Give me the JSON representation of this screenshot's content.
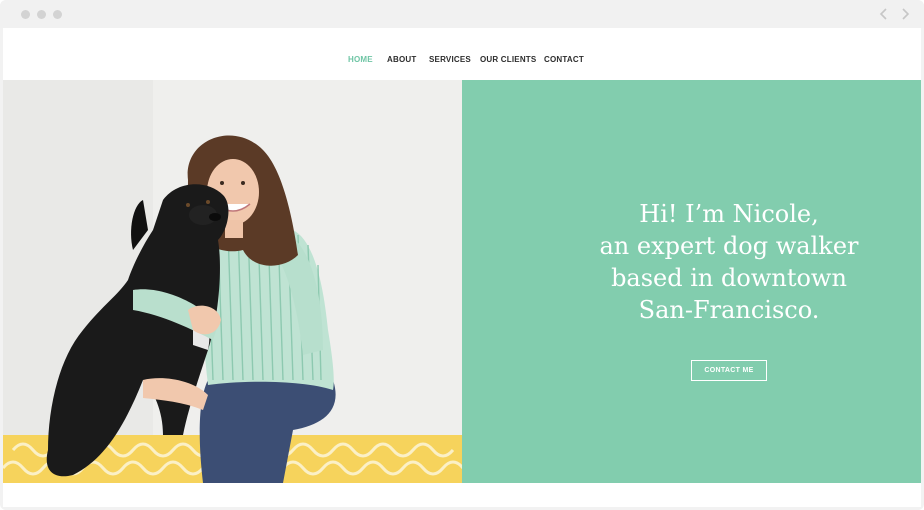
{
  "window": {
    "controls": [
      "close-dot",
      "minimize-dot",
      "zoom-dot"
    ],
    "back_icon": "chevron-left-icon",
    "forward_icon": "chevron-right-icon"
  },
  "nav": {
    "items": [
      {
        "label": "HOME",
        "active": true
      },
      {
        "label": "ABOUT",
        "active": false
      },
      {
        "label": "SERVICES",
        "active": false
      },
      {
        "label": "OUR CLIENTS",
        "active": false
      },
      {
        "label": "CONTACT",
        "active": false
      }
    ],
    "active_color": "#6fc5a5"
  },
  "hero": {
    "headline_lines": [
      "Hi! I’m Nicole,",
      "an expert dog walker",
      "based in downtown",
      "San-Francisco."
    ],
    "cta_label": "CONTACT ME",
    "panel_color": "#82cdae"
  }
}
